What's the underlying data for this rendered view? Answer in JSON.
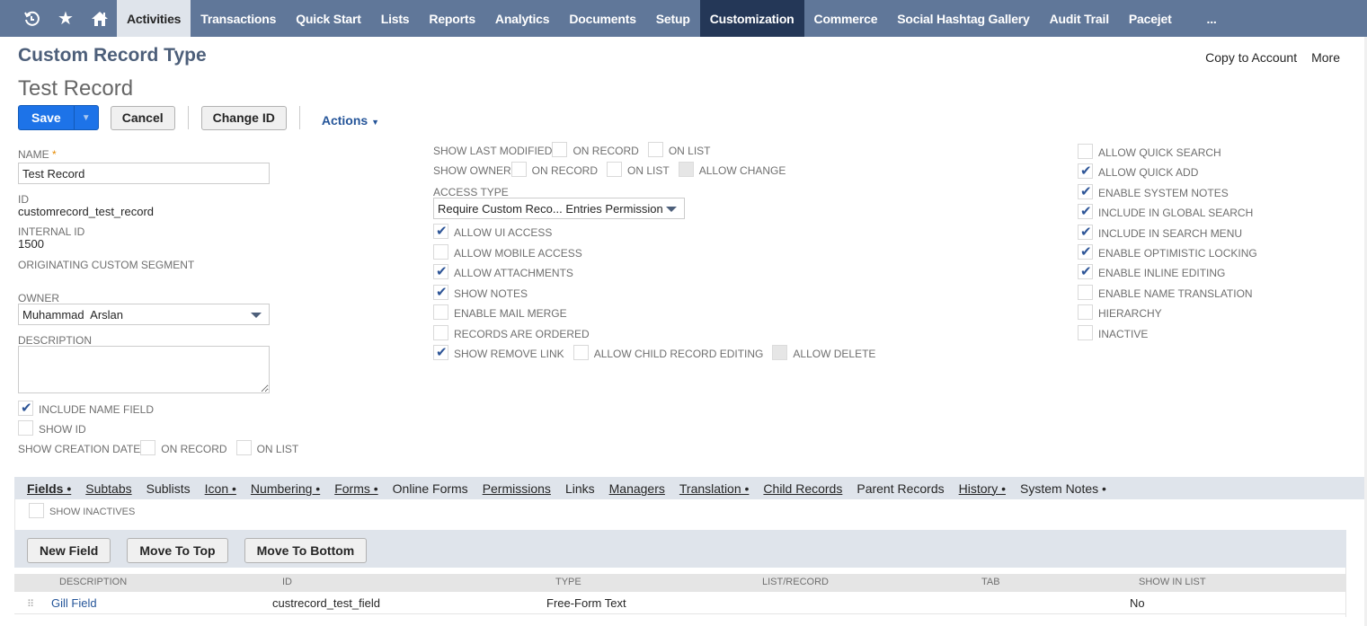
{
  "navbar": {
    "icons": [
      "recent-icon",
      "star-icon",
      "home-icon"
    ],
    "items": [
      {
        "label": "Activities",
        "state": "active-light"
      },
      {
        "label": "Transactions"
      },
      {
        "label": "Quick Start"
      },
      {
        "label": "Lists"
      },
      {
        "label": "Reports"
      },
      {
        "label": "Analytics"
      },
      {
        "label": "Documents"
      },
      {
        "label": "Setup"
      },
      {
        "label": "Customization",
        "state": "active-dark"
      },
      {
        "label": "Commerce"
      },
      {
        "label": "Social Hashtag Gallery"
      },
      {
        "label": "Audit Trail"
      },
      {
        "label": "Pacejet"
      }
    ],
    "more_label": "..."
  },
  "header": {
    "page_title": "Custom Record Type",
    "record_title": "Test Record",
    "copy_to_account": "Copy to Account",
    "more": "More"
  },
  "toolbar": {
    "save_label": "Save",
    "cancel_label": "Cancel",
    "change_id_label": "Change ID",
    "actions_label": "Actions"
  },
  "form": {
    "name_label": "NAME",
    "name_required": "*",
    "name_value": "Test Record",
    "id_label": "ID",
    "id_value": "customrecord_test_record",
    "internal_id_label": "INTERNAL ID",
    "internal_id_value": "1500",
    "originating_segment_label": "ORIGINATING CUSTOM SEGMENT",
    "owner_label": "OWNER",
    "owner_value": "Muhammad  Arslan",
    "description_label": "DESCRIPTION",
    "description_value": "",
    "include_name_field": {
      "label": "INCLUDE NAME FIELD",
      "checked": true
    },
    "show_id": {
      "label": "SHOW ID",
      "checked": false
    },
    "show_creation_date": {
      "label": "SHOW CREATION DATE",
      "on_record": "ON RECORD",
      "on_list": "ON LIST",
      "on_record_checked": false,
      "on_list_checked": false
    },
    "show_last_modified": {
      "label": "SHOW LAST MODIFIED",
      "on_record": "ON RECORD",
      "on_list": "ON LIST",
      "on_record_checked": false,
      "on_list_checked": false
    },
    "show_owner": {
      "label": "SHOW OWNER",
      "on_record": "ON RECORD",
      "on_list": "ON LIST",
      "allow_change": "ALLOW CHANGE",
      "on_record_checked": false,
      "on_list_checked": false,
      "allow_change_checked": false
    },
    "access_type_label": "ACCESS TYPE",
    "access_type_value": "Require Custom Reco... Entries Permission",
    "middle_checkboxes": [
      {
        "label": "ALLOW UI ACCESS",
        "checked": true
      },
      {
        "label": "ALLOW MOBILE ACCESS",
        "checked": false
      },
      {
        "label": "ALLOW ATTACHMENTS",
        "checked": true
      },
      {
        "label": "SHOW NOTES",
        "checked": true
      },
      {
        "label": "ENABLE MAIL MERGE",
        "checked": false
      },
      {
        "label": "RECORDS ARE ORDERED",
        "checked": false
      }
    ],
    "show_remove_link": {
      "label": "SHOW REMOVE LINK",
      "checked": true
    },
    "allow_child_record_editing": {
      "label": "ALLOW CHILD RECORD EDITING",
      "checked": false
    },
    "allow_delete": {
      "label": "ALLOW DELETE",
      "checked": false
    },
    "right_checkboxes": [
      {
        "label": "ALLOW QUICK SEARCH",
        "checked": false
      },
      {
        "label": "ALLOW QUICK ADD",
        "checked": true
      },
      {
        "label": "ENABLE SYSTEM NOTES",
        "checked": true
      },
      {
        "label": "INCLUDE IN GLOBAL SEARCH",
        "checked": true
      },
      {
        "label": "INCLUDE IN SEARCH MENU",
        "checked": true
      },
      {
        "label": "ENABLE OPTIMISTIC LOCKING",
        "checked": true
      },
      {
        "label": "ENABLE INLINE EDITING",
        "checked": true
      },
      {
        "label": "ENABLE NAME TRANSLATION",
        "checked": false
      },
      {
        "label": "HIERARCHY",
        "checked": false
      },
      {
        "label": "INACTIVE",
        "checked": false
      }
    ]
  },
  "subtabs": [
    {
      "label": "Fields •",
      "active": true
    },
    {
      "label": "Subtabs"
    },
    {
      "label": "Sublists"
    },
    {
      "label": "Icon •"
    },
    {
      "label": "Numbering •"
    },
    {
      "label": "Forms •"
    },
    {
      "label": "Online Forms"
    },
    {
      "label": "Permissions"
    },
    {
      "label": "Links"
    },
    {
      "label": "Managers"
    },
    {
      "label": "Translation •"
    },
    {
      "label": "Child Records"
    },
    {
      "label": "Parent Records"
    },
    {
      "label": "History •"
    },
    {
      "label": "System Notes •"
    }
  ],
  "fields_tab": {
    "show_inactives": {
      "label": "SHOW INACTIVES",
      "checked": false
    },
    "buttons": {
      "new_field": "New Field",
      "move_to_top": "Move To Top",
      "move_to_bottom": "Move To Bottom"
    },
    "columns": [
      "DESCRIPTION",
      "ID",
      "TYPE",
      "LIST/RECORD",
      "TAB",
      "SHOW IN LIST"
    ],
    "rows": [
      {
        "description": "Gill Field",
        "id": "custrecord_test_field",
        "type": "Free-Form Text",
        "list_record": "",
        "tab": "",
        "show_in_list": "No"
      }
    ]
  }
}
